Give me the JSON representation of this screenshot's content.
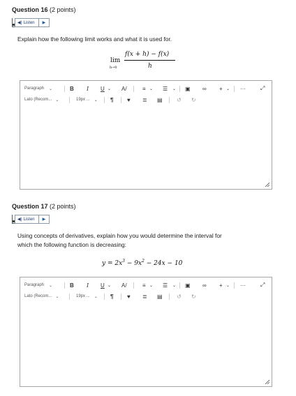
{
  "questions": [
    {
      "title": "Question 16",
      "points": "(2 points)",
      "listen_label": "Listen",
      "prompt": "Explain how the following limit works and what it is used for.",
      "math": {
        "lim": "lim",
        "sub": "h→0",
        "numerator": "f(x + h) − f(x)",
        "denominator": "h"
      }
    },
    {
      "title": "Question 17",
      "points": "(2 points)",
      "listen_label": "Listen",
      "prompt_line1": "Using concepts of derivatives, explain how you would determine the interval for",
      "prompt_line2": "which the following function is decreasing:",
      "math": {
        "lhs": "y = 2x",
        "e1": "3",
        "mid": " − 9x",
        "e2": "2",
        "rest": " − 24x − 10"
      }
    }
  ],
  "toolbar": {
    "paragraph": "Paragraph",
    "font": "Lato (Recom...",
    "size": "19px ...",
    "bold": "B",
    "italic": "I",
    "underline": "U",
    "more": "···",
    "plus": "+"
  }
}
